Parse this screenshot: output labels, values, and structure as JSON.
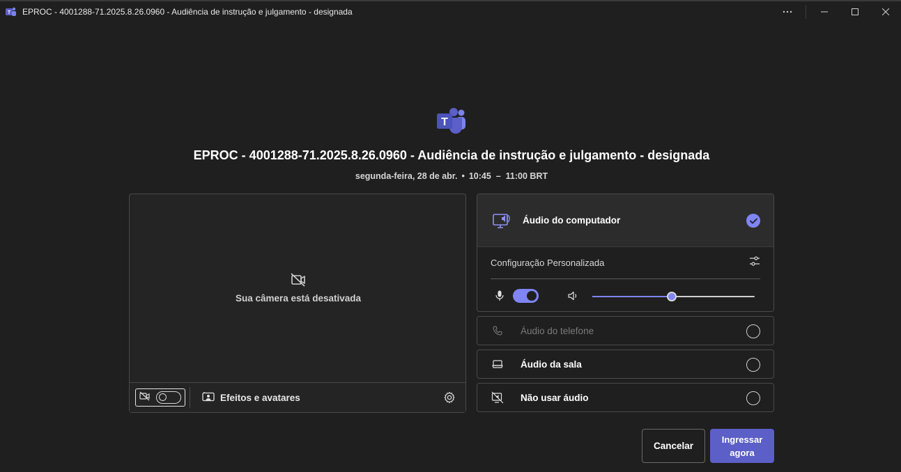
{
  "window": {
    "title": "EPROC - 4001288-71.2025.8.26.0960 - Audiência de instrução e julgamento - designada",
    "more_icon": "ellipsis-icon",
    "minimize_icon": "minimize-icon",
    "maximize_icon": "maximize-icon",
    "close_icon": "close-icon"
  },
  "meeting": {
    "title": "EPROC - 4001288-71.2025.8.26.0960 - Audiência de instrução e julgamento - designada",
    "date": "segunda-feira, 28 de abr.",
    "separator": "•",
    "time_range": "10:45  –  11:00 BRT"
  },
  "camera": {
    "off_message": "Sua câmera está desativada",
    "toggle_state": "off",
    "effects_label": "Efeitos e avatares"
  },
  "audio": {
    "computer": {
      "label": "Áudio do computador",
      "selected": true,
      "custom_label": "Configuração Personalizada",
      "mic_on": true,
      "volume_fraction": 0.49
    },
    "options": [
      {
        "label": "Áudio do telefone",
        "icon": "phone-icon",
        "disabled": true
      },
      {
        "label": "Áudio da sala",
        "icon": "room-icon",
        "disabled": false
      },
      {
        "label": "Não usar áudio",
        "icon": "no-audio-icon",
        "disabled": false
      }
    ]
  },
  "actions": {
    "cancel_label": "Cancelar",
    "join_label": "Ingressar agora"
  },
  "colors": {
    "background": "#1f1f1f",
    "accent": "#7f85f5",
    "primary_button": "#5b5fc7"
  }
}
